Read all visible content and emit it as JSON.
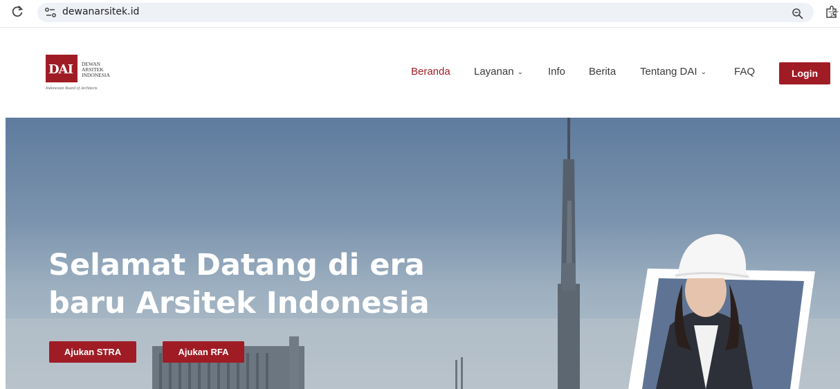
{
  "browser": {
    "url": "dewanarsitek.id"
  },
  "header": {
    "logo": {
      "mark": "DAI",
      "words": [
        "DEWAN",
        "ARSITEK",
        "INDONESIA"
      ],
      "tagline": "Indonesian Board of Architects"
    },
    "nav": [
      {
        "label": "Beranda",
        "active": true,
        "dropdown": false
      },
      {
        "label": "Layanan",
        "active": false,
        "dropdown": true
      },
      {
        "label": "Info",
        "active": false,
        "dropdown": false
      },
      {
        "label": "Berita",
        "active": false,
        "dropdown": false
      },
      {
        "label": "Tentang DAI",
        "active": false,
        "dropdown": true
      },
      {
        "label": "FAQ",
        "active": false,
        "dropdown": false
      }
    ],
    "login_label": "Login"
  },
  "hero": {
    "title_line1": "Selamat Datang di era",
    "title_line2": "baru Arsitek Indonesia",
    "button_stra": "Ajukan STRA",
    "button_rfa": "Ajukan RFA"
  },
  "colors": {
    "brand": "#a01c25",
    "active_nav": "#a01c25"
  }
}
